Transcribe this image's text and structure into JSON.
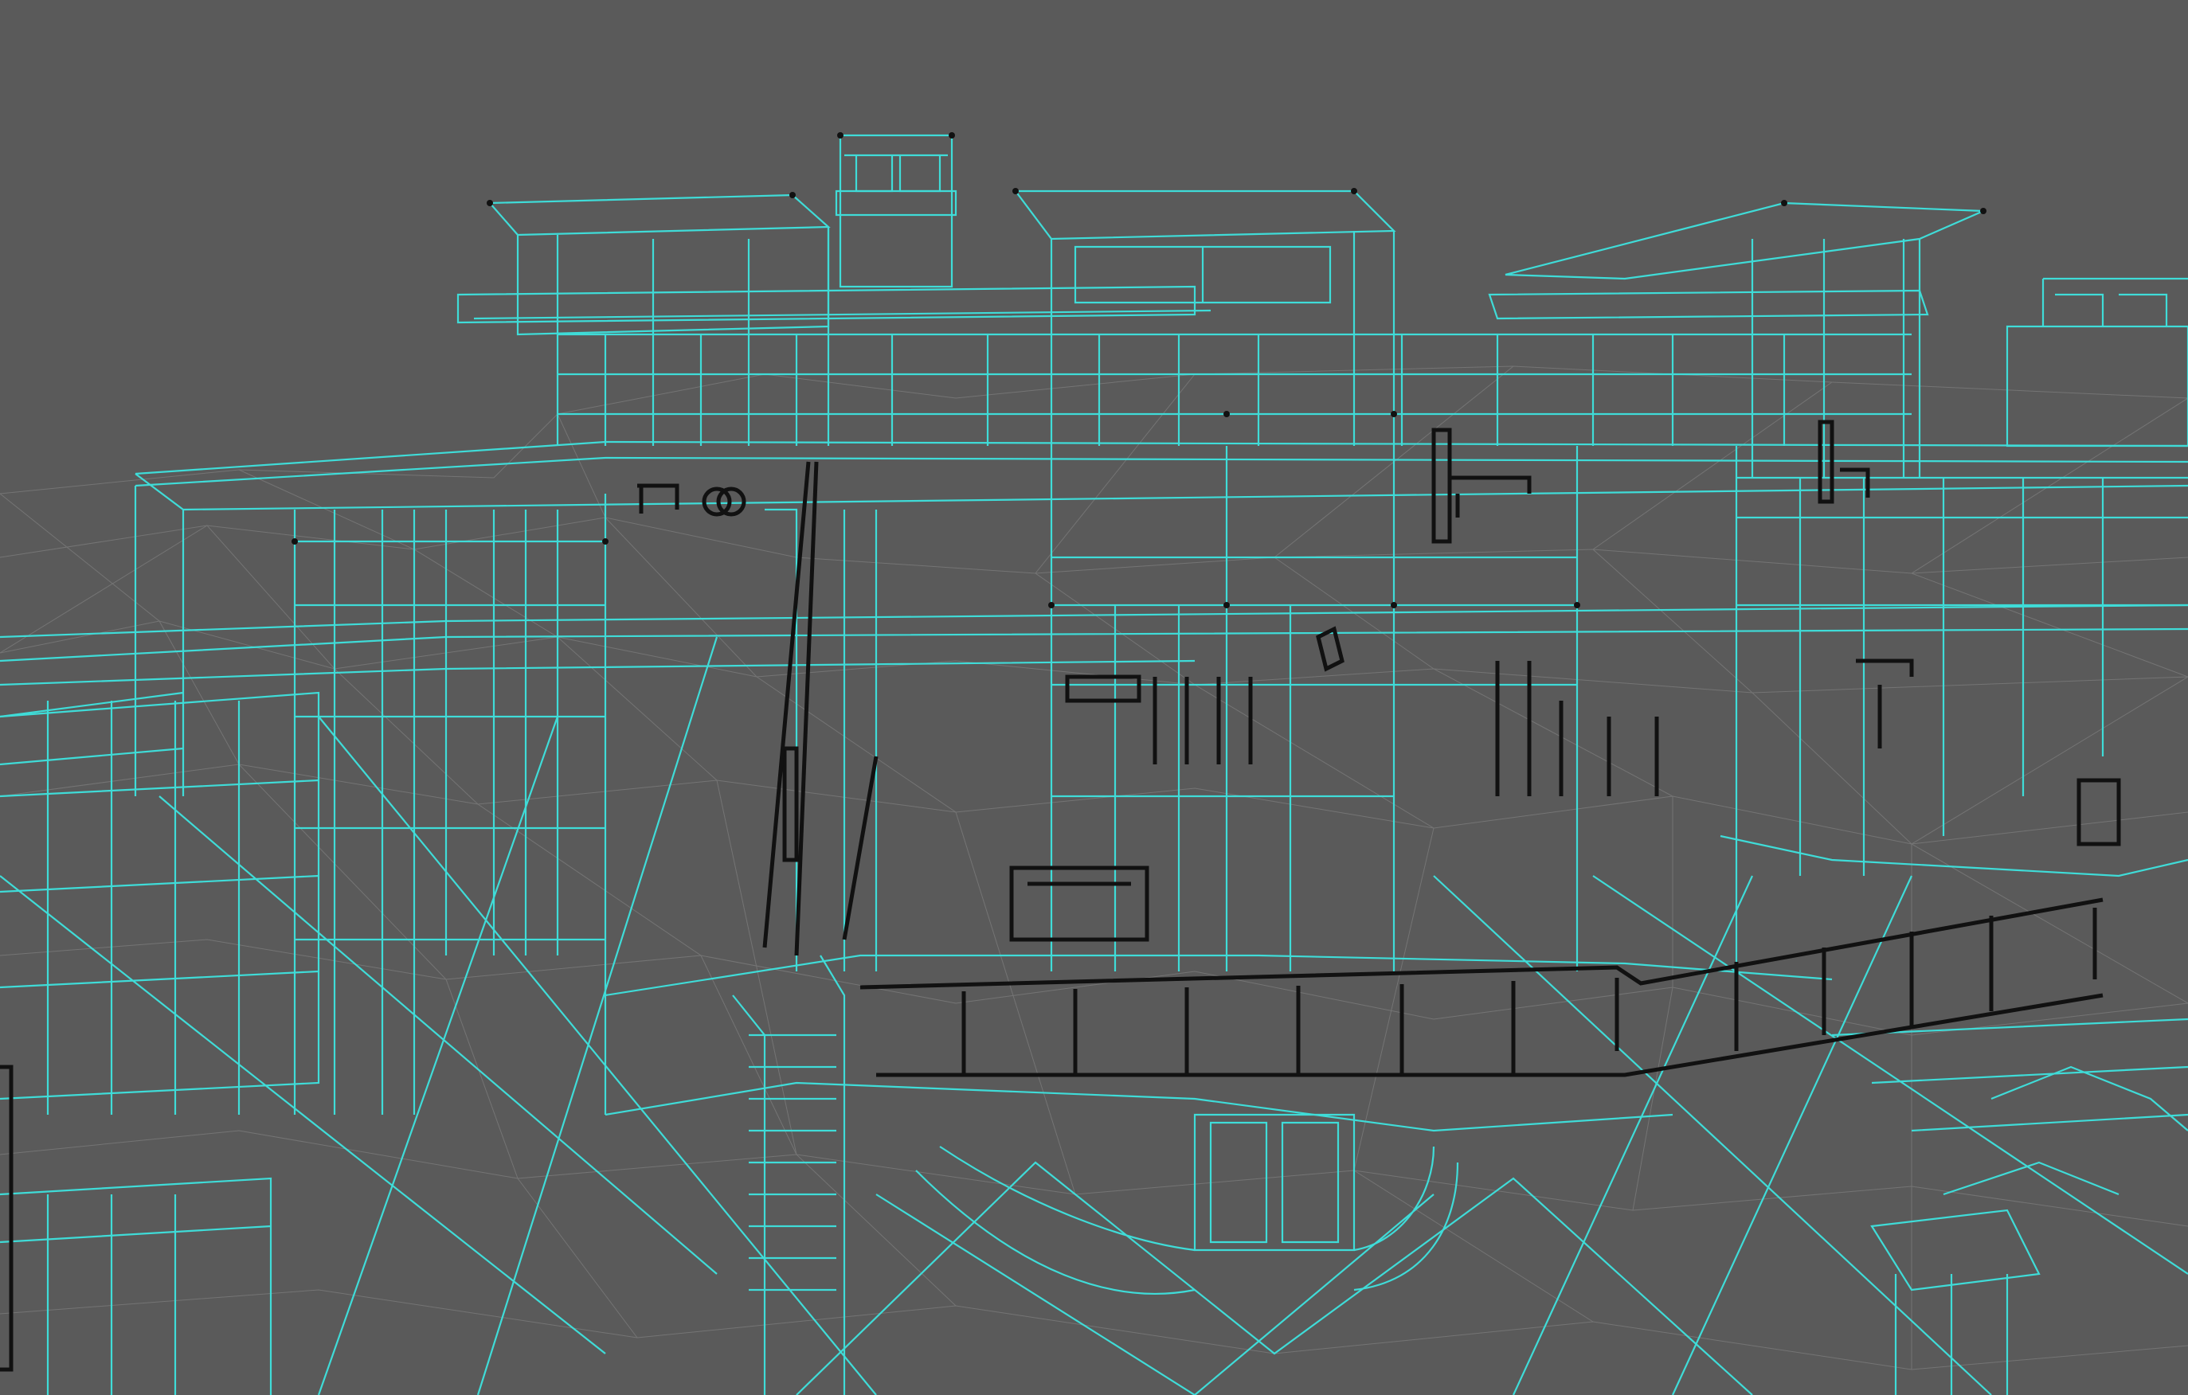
{
  "viewport": {
    "mode": "wireframe",
    "view": "perspective",
    "background_color": "#5a5a5a",
    "wire_color": "#3fdcd8",
    "vertex_color": "#111111",
    "subject": "house-model"
  }
}
